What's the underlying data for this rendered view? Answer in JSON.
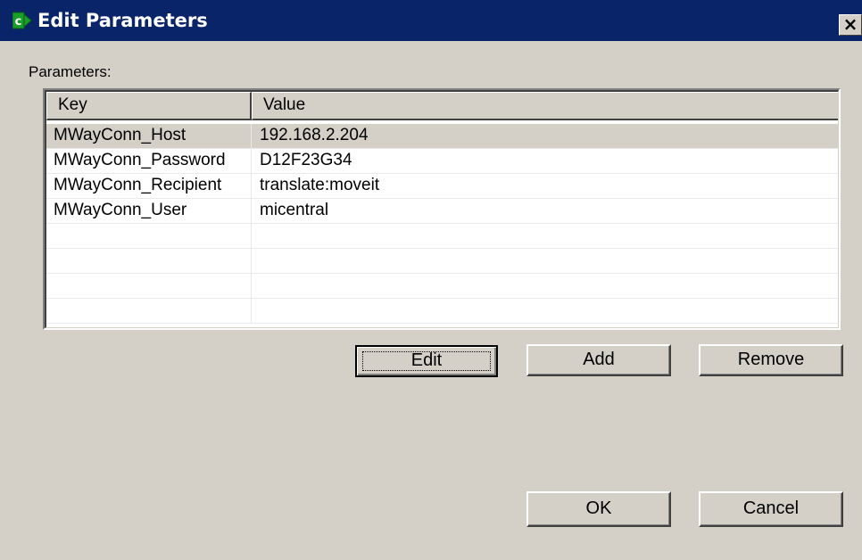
{
  "window": {
    "title": "Edit Parameters",
    "icon": "green-arrow-c-app-icon",
    "close_label": "×"
  },
  "parameters": {
    "label": "Parameters:",
    "columns": [
      "Key",
      "Value"
    ],
    "rows": [
      {
        "key": "MWayConn_Host",
        "value": "192.168.2.204",
        "selected": true
      },
      {
        "key": "MWayConn_Password",
        "value": "D12F23G34",
        "selected": false
      },
      {
        "key": "MWayConn_Recipient",
        "value": "translate:moveit",
        "selected": false
      },
      {
        "key": "MWayConn_User",
        "value": "micentral",
        "selected": false
      },
      {
        "key": "",
        "value": "",
        "selected": false
      },
      {
        "key": "",
        "value": "",
        "selected": false
      },
      {
        "key": "",
        "value": "",
        "selected": false
      },
      {
        "key": "",
        "value": "",
        "selected": false
      }
    ]
  },
  "buttons": {
    "edit": "Edit",
    "add": "Add",
    "remove": "Remove",
    "ok": "OK",
    "cancel": "Cancel"
  },
  "colors": {
    "titlebar": "#0a246a",
    "dialog_face": "#d4d0c8",
    "list_background": "#ffffff",
    "icon_green": "#1a9e2a"
  }
}
